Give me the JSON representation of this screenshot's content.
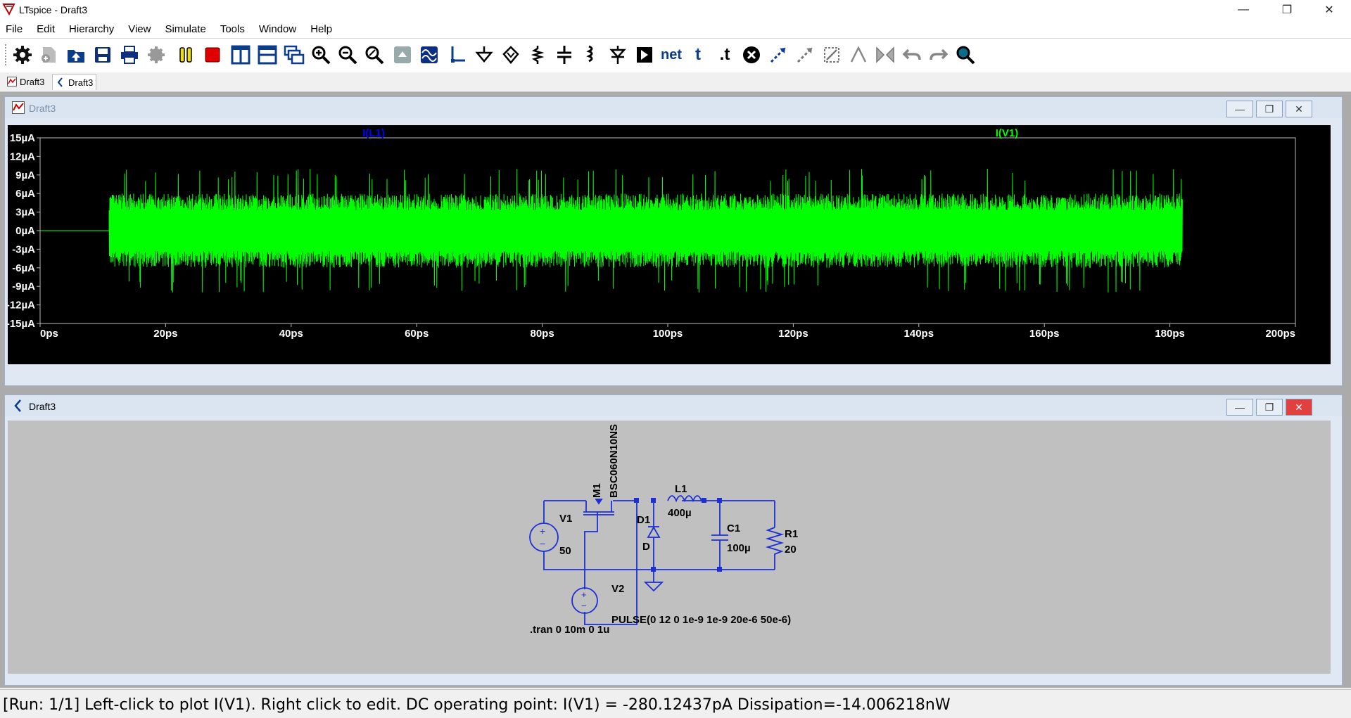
{
  "window": {
    "title": "LTspice - Draft3",
    "controls": {
      "minimize": "—",
      "restore": "❐",
      "close": "✕"
    }
  },
  "menu": [
    "File",
    "Edit",
    "Hierarchy",
    "View",
    "Simulate",
    "Tools",
    "Window",
    "Help"
  ],
  "toolbar": {
    "icons": [
      "gear-icon",
      "new-schematic-icon",
      "open-icon",
      "save-icon",
      "print-icon",
      "control-panel-icon",
      "pause-icon",
      "halt-icon",
      "tile-vertical-icon",
      "tile-horizontal-icon",
      "cascade-icon",
      "zoom-in-icon",
      "zoom-out-icon",
      "zoom-fit-icon",
      "autorange-icon",
      "waveform-icon",
      "wire-icon",
      "ground-icon",
      "label-net-icon",
      "resistor-icon",
      "capacitor-icon",
      "inductor-icon",
      "diode-icon",
      "component-icon",
      "net-label-icon",
      "text-icon",
      "spice-directive-icon",
      "delete-icon",
      "move-icon",
      "drag-icon",
      "rotate-icon",
      "mirror-icon",
      "flip-icon",
      "undo-icon",
      "redo-icon",
      "find-icon"
    ],
    "net_label": "net",
    "text_label": "t",
    "directive_label": ".t"
  },
  "tabs": [
    {
      "label": "Draft3",
      "kind": "waveform",
      "active": false
    },
    {
      "label": "Draft3",
      "kind": "schematic",
      "active": true
    }
  ],
  "plot_window": {
    "title": "Draft3",
    "traces": [
      {
        "name": "I(L1)",
        "color": "#0000ff"
      },
      {
        "name": "I(V1)",
        "color": "#00ff00"
      }
    ]
  },
  "chart_data": {
    "type": "line",
    "title": "",
    "xlabel": "",
    "ylabel": "",
    "xlim": [
      0,
      200
    ],
    "ylim": [
      -15,
      15
    ],
    "x_ticks": [
      "0ps",
      "20ps",
      "40ps",
      "60ps",
      "80ps",
      "100ps",
      "120ps",
      "140ps",
      "160ps",
      "180ps",
      "200ps"
    ],
    "y_ticks": [
      "15µA",
      "12µA",
      "9µA",
      "6µA",
      "3µA",
      "0µA",
      "-3µA",
      "-6µA",
      "-9µA",
      "-12µA",
      "-15µA"
    ],
    "grid": false,
    "series": [
      {
        "name": "I(V1)",
        "color": "#00ff00",
        "x_start": 0,
        "x_signal_start": 11,
        "x_end": 182,
        "baseline": 0,
        "typical_amplitude": 6,
        "peak_amplitude": 10
      },
      {
        "name": "I(L1)",
        "color": "#0000ff",
        "values": []
      }
    ]
  },
  "schematic_window": {
    "title": "Draft3",
    "labels": {
      "m1": "M1",
      "m1_model": "BSC060N10NS",
      "l1": "L1",
      "l1_value": "400µ",
      "d1": "D1",
      "d1_model": "D",
      "c1": "C1",
      "c1_value": "100µ",
      "r1": "R1",
      "r1_value": "20",
      "v1": "V1",
      "v1_value": "50",
      "v2": "V2",
      "v2_value": "PULSE(0 12 0 1e-9 1e-9 20e-6 50e-6)",
      "directive": ".tran 0 10m 0 1u"
    }
  },
  "status": "[Run: 1/1] Left-click to plot I(V1).  Right click to edit.  DC operating point: I(V1) = -280.12437pA   Dissipation=-14.006218nW"
}
